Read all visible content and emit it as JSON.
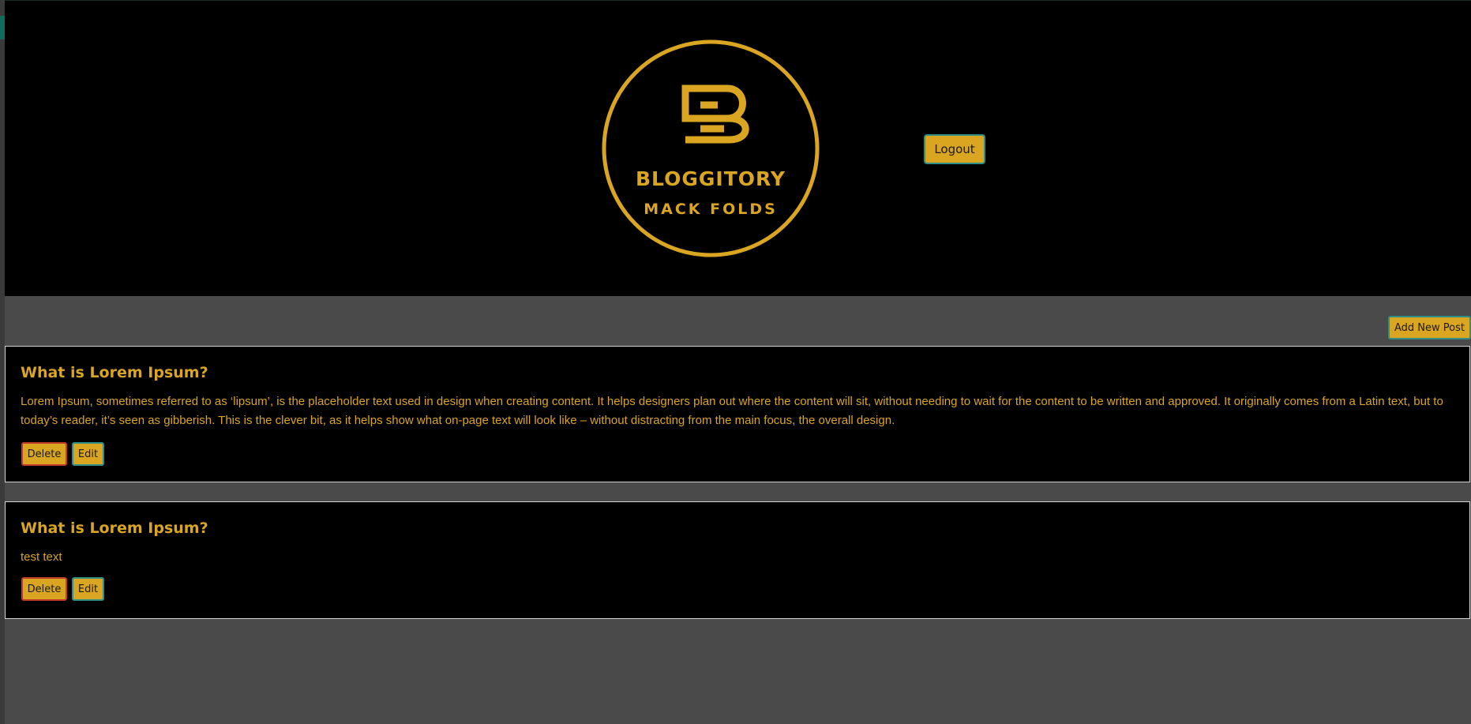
{
  "header": {
    "logo": {
      "title": "BLOGGITORY",
      "subtitle": "MACK FOLDS",
      "monogram": "B",
      "color": "#daa520"
    },
    "logout_label": "Logout"
  },
  "toolbar": {
    "add_post_label": "Add New Post"
  },
  "posts": [
    {
      "title": "What is Lorem Ipsum?",
      "body": "Lorem Ipsum, sometimes referred to as ‘lipsum’, is the placeholder text used in design when creating content. It helps designers plan out where the content will sit, without needing to wait for the content to be written and approved. It originally comes from a Latin text, but to today’s reader, it’s seen as gibberish. This is the clever bit, as it helps show what on-page text will look like – without distracting from the main focus, the overall design.",
      "delete_label": "Delete",
      "edit_label": "Edit"
    },
    {
      "title": "What is Lorem Ipsum?",
      "body": "test text",
      "delete_label": "Delete",
      "edit_label": "Edit"
    }
  ],
  "colors": {
    "accent": "#daa520",
    "background": "#4a4a4a",
    "card": "#000000"
  }
}
